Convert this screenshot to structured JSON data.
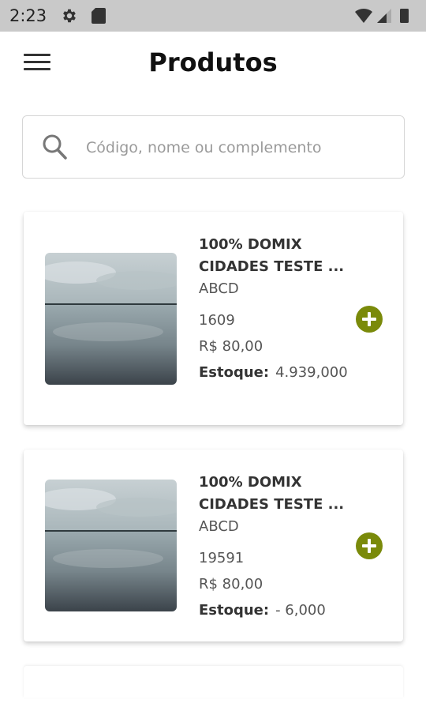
{
  "status_bar": {
    "time": "2:23"
  },
  "header": {
    "title": "Produtos"
  },
  "search": {
    "placeholder": "Código, nome ou complemento"
  },
  "products": [
    {
      "name": "100% DOMIX CIDADES TESTE ...",
      "subtitle": "ABCD",
      "code": "1609",
      "price": "R$  80,00",
      "stock_label": "Estoque:",
      "stock_value": "4.939,000"
    },
    {
      "name": "100% DOMIX CIDADES TESTE ...",
      "subtitle": "ABCD",
      "code": "19591",
      "price": "R$  80,00",
      "stock_label": "Estoque:",
      "stock_value": "- 6,000"
    }
  ],
  "colors": {
    "accent": "#7a8a0a",
    "status_bar": "#c9c9c9"
  },
  "icons": {
    "menu": "hamburger-icon",
    "search": "search-icon",
    "add": "plus-circle-icon"
  }
}
